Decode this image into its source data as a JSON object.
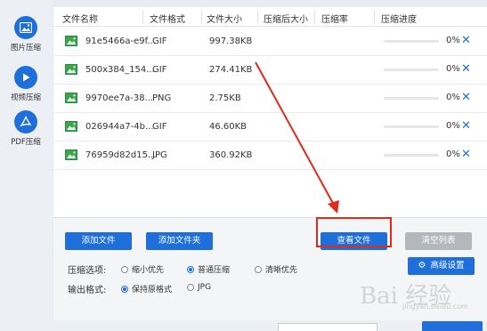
{
  "sidebar": {
    "items": [
      {
        "label": "图片压缩",
        "icon": "image-icon"
      },
      {
        "label": "视频压缩",
        "icon": "play-icon"
      },
      {
        "label": "PDF压缩",
        "icon": "pdf-icon"
      }
    ]
  },
  "table": {
    "headers": [
      "文件名称",
      "文件格式",
      "文件大小",
      "压缩后大小",
      "压缩率",
      "压缩进度"
    ],
    "rows": [
      {
        "name": "91e5466a-e9f...",
        "format": "GIF",
        "size": "997.38KB",
        "compressed_size": "",
        "ratio": "",
        "progress": "0%",
        "progress_value": 0
      },
      {
        "name": "500x384_154...",
        "format": "GIF",
        "size": "274.41KB",
        "compressed_size": "",
        "ratio": "",
        "progress": "0%",
        "progress_value": 0
      },
      {
        "name": "9970ee7a-38...",
        "format": "PNG",
        "size": "2.75KB",
        "compressed_size": "",
        "ratio": "",
        "progress": "0%",
        "progress_value": 0
      },
      {
        "name": "026944a7-4b...",
        "format": "GIF",
        "size": "46.60KB",
        "compressed_size": "",
        "ratio": "",
        "progress": "0%",
        "progress_value": 0
      },
      {
        "name": "76959d82d15...",
        "format": "JPG",
        "size": "360.92KB",
        "compressed_size": "",
        "ratio": "",
        "progress": "0%",
        "progress_value": 0
      }
    ],
    "delete_symbol": "✕"
  },
  "toolbar": {
    "add_file": "添加文件",
    "add_folder": "添加文件夹",
    "view_files": "查看文件",
    "clear_list": "清空列表",
    "advanced_settings": "高级设置"
  },
  "options": {
    "compress_label": "压缩选项:",
    "compress_choices": [
      "缩小优先",
      "普通压缩",
      "清晰优先"
    ],
    "compress_selected": "普通压缩",
    "format_label": "输出格式:",
    "format_choices": [
      "保持原格式",
      "JPG"
    ],
    "format_selected": "保持原格式"
  },
  "watermark": {
    "text": "Bai 经验",
    "sub": "jingyan.baidu.com"
  },
  "colors": {
    "accent": "#1e6fd9",
    "annotation": "#e02a1a",
    "disabled_button": "#b4b7bc"
  }
}
